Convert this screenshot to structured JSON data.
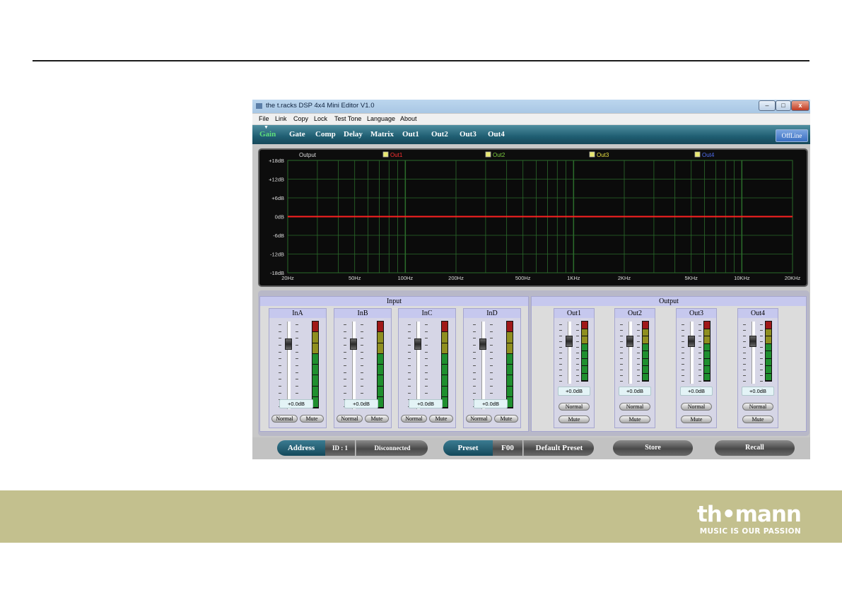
{
  "window": {
    "title": "the t.racks DSP 4x4 Mini Editor V1.0",
    "controls": {
      "minimize": "–",
      "maximize": "□",
      "close": "x"
    }
  },
  "menu": [
    "File",
    "Link",
    "Copy",
    "Lock",
    "Test Tone",
    "Language",
    "About"
  ],
  "tabs": [
    {
      "label": "Gain",
      "active": true
    },
    {
      "label": "Gate"
    },
    {
      "label": "Comp"
    },
    {
      "label": "Delay"
    },
    {
      "label": "Matrix"
    },
    {
      "label": "Out1"
    },
    {
      "label": "Out2"
    },
    {
      "label": "Out3"
    },
    {
      "label": "Out4"
    }
  ],
  "offline_button": "OffLine",
  "graph": {
    "label": "Output",
    "legend": [
      {
        "name": "Out1",
        "color": "#ff3030"
      },
      {
        "name": "Out2",
        "color": "#7fd040"
      },
      {
        "name": "Out3",
        "color": "#e8e040"
      },
      {
        "name": "Out4",
        "color": "#4f6df0"
      }
    ],
    "y_ticks": [
      "+18dB",
      "+12dB",
      "+6dB",
      "0dB",
      "-6dB",
      "-12dB",
      "-18dB"
    ],
    "x_ticks": [
      "20Hz",
      "50Hz",
      "100Hz",
      "200Hz",
      "500Hz",
      "1KHz",
      "2KHz",
      "5KHz",
      "10KHz",
      "20KHz"
    ],
    "curve_color": "#ff2020",
    "grid_color": "#2b6b2b",
    "curve_gain_db": 0
  },
  "input": {
    "title": "Input",
    "channels": [
      {
        "name": "InA",
        "gain": "+0.0dB",
        "normal": "Normal",
        "mute": "Mute"
      },
      {
        "name": "InB",
        "gain": "+0.0dB",
        "normal": "Normal",
        "mute": "Mute"
      },
      {
        "name": "InC",
        "gain": "+0.0dB",
        "normal": "Normal",
        "mute": "Mute"
      },
      {
        "name": "InD",
        "gain": "+0.0dB",
        "normal": "Normal",
        "mute": "Mute"
      }
    ]
  },
  "output": {
    "title": "Output",
    "channels": [
      {
        "name": "Out1",
        "gain": "+0.0dB",
        "normal": "Normal",
        "mute": "Mute"
      },
      {
        "name": "Out2",
        "gain": "+0.0dB",
        "normal": "Normal",
        "mute": "Mute"
      },
      {
        "name": "Out3",
        "gain": "+0.0dB",
        "normal": "Normal",
        "mute": "Mute"
      },
      {
        "name": "Out4",
        "gain": "+0.0dB",
        "normal": "Normal",
        "mute": "Mute"
      }
    ]
  },
  "status": {
    "address_label": "Address",
    "id": "ID : 1",
    "connection": "Disconnected",
    "preset_label": "Preset",
    "preset_code": "F00",
    "preset_name": "Default Preset",
    "store": "Store",
    "recall": "Recall"
  },
  "logo": {
    "wordmark": "th•mann",
    "tagline": "MUSIC IS OUR PASSION"
  }
}
